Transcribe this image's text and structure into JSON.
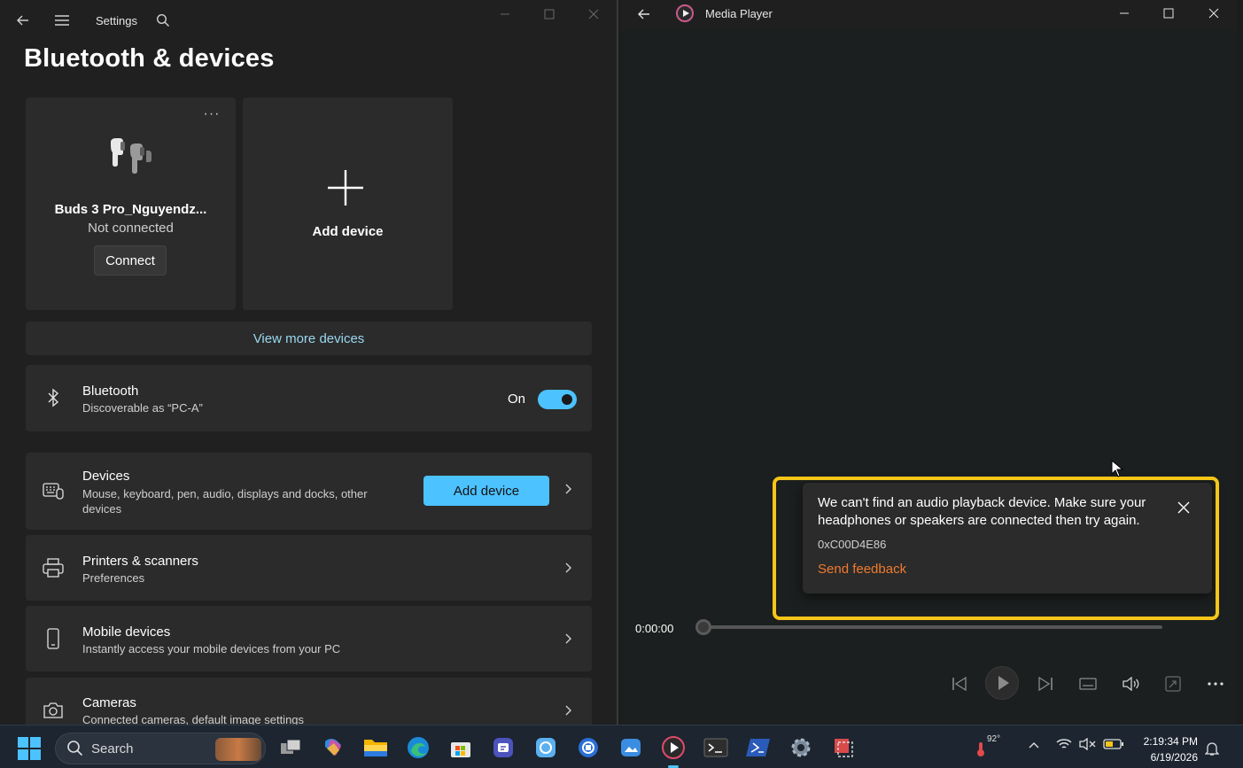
{
  "settings": {
    "app_title": "Settings",
    "page_title": "Bluetooth & devices",
    "device_card": {
      "name": "Buds 3 Pro_Nguyendz...",
      "status": "Not connected",
      "connect_label": "Connect",
      "menu_glyph": "···"
    },
    "add_card": {
      "label": "Add device"
    },
    "view_more": "View more devices",
    "bluetooth": {
      "title": "Bluetooth",
      "subtitle": "Discoverable as “PC-A”",
      "toggle_label": "On",
      "toggle_on": true
    },
    "devices": {
      "title": "Devices",
      "subtitle": "Mouse, keyboard, pen, audio, displays and docks, other devices",
      "button_label": "Add device"
    },
    "printers": {
      "title": "Printers & scanners",
      "subtitle": "Preferences"
    },
    "mobile": {
      "title": "Mobile devices",
      "subtitle": "Instantly access your mobile devices from your PC"
    },
    "cameras": {
      "title": "Cameras",
      "subtitle": "Connected cameras, default image settings"
    }
  },
  "media_player": {
    "title": "Media Player",
    "toast": {
      "message": "We can't find an audio playback device. Make sure your headphones or speakers are connected then try again.",
      "code": "0xC00D4E86",
      "link": "Send feedback"
    },
    "time": "0:00:00",
    "progress": 0
  },
  "taskbar": {
    "search_label": "Search",
    "weather_temp": "92°",
    "time": "2:19:34 PM",
    "date": "6/19/2026",
    "apps": [
      "task-view",
      "m365",
      "file-explorer",
      "edge",
      "store",
      "teams",
      "snipping-tool",
      "remote-connect",
      "photos",
      "media-player",
      "terminal",
      "powershell",
      "settings",
      "snip-sketch"
    ]
  },
  "colors": {
    "accent": "#4cc2ff",
    "highlight_outline": "#f5c518",
    "feedback_link": "#f07a2e"
  }
}
